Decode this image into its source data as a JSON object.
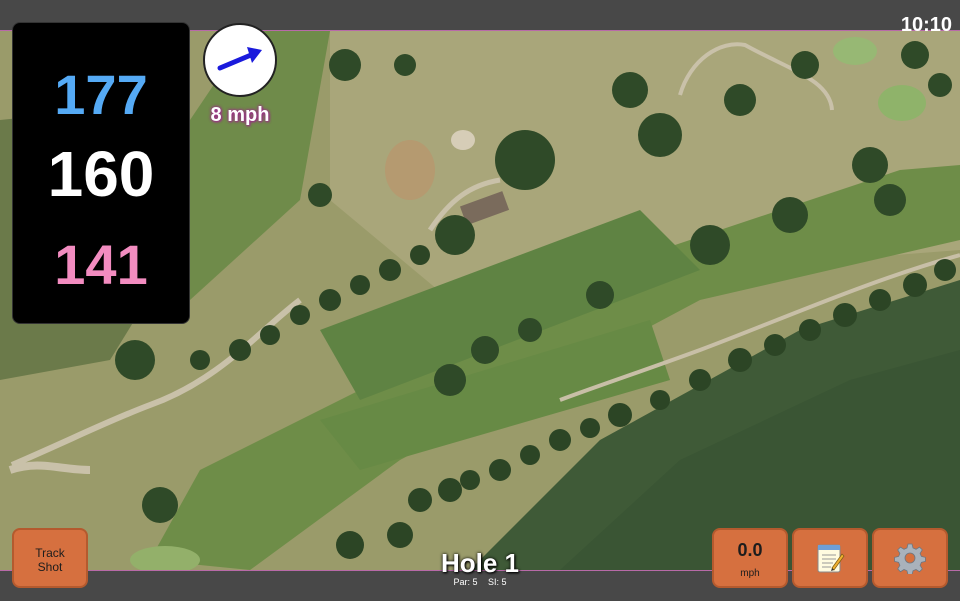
{
  "status": {
    "time": "10:10"
  },
  "distances": {
    "back": "177",
    "middle": "160",
    "front": "141"
  },
  "wind": {
    "speed_label": "8 mph",
    "icon": "wind-direction-arrow-icon"
  },
  "hole": {
    "title": "Hole 1",
    "par_label": "Par: 5",
    "si_label": "SI: 5"
  },
  "buttons": {
    "track_line1": "Track",
    "track_line2": "Shot",
    "speed_value": "0.0",
    "speed_unit": "mph",
    "notes_icon": "notepad-icon",
    "settings_icon": "gear-icon"
  },
  "colors": {
    "back_distance": "#55aaf5",
    "middle_distance": "#ffffff",
    "front_distance": "#f28cc0",
    "button_bg": "#d6703f",
    "bar_accent": "#b86aa8"
  }
}
